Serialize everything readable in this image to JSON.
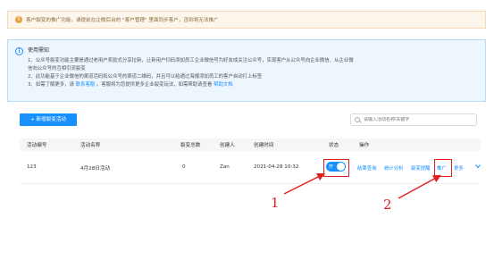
{
  "warning": {
    "text": "客户裂变的推广功能，请提前在企微后台的 \"客户管理\" 里面同步客户，否则将无法推广"
  },
  "notice": {
    "title": "使用需知",
    "lines": [
      "1、公众号裂变功能主要是通过老用户奖励式分享拉新，让新用户扫码添加员工企业微信号为好友成关注公众号，实现客户从公众号向企业微信、从企业微",
      "信向公众号的互相引流裂变",
      "2、此功能基于企业微信的渠道活码和公众号的渠道二维码，并且可以给通过海报添加员工的客户自动打上标签",
      "3、如需了解更多，请"
    ],
    "link1": "联系客服",
    "line3_mid": "。客服将为您提供更多企业裂变玩法，如需帮助请查看",
    "link2": "帮助文档"
  },
  "toolbar": {
    "new_button": "+ 新增裂变活动",
    "search_placeholder": "请输入活动名称/关键字"
  },
  "table": {
    "headers": [
      "活动编号",
      "活动名称",
      "裂变总数",
      "创建人",
      "创建时间",
      "状态",
      "操作"
    ],
    "rows": [
      {
        "id": "123",
        "name": "4月28日活动",
        "total": "0",
        "creator": "Zan",
        "created": "2021-04-28  10:32",
        "status_label": "开",
        "actions": [
          "结果查询",
          "统计分析",
          "裂变提醒",
          "推广",
          "更多"
        ]
      }
    ]
  },
  "annotations": {
    "label1": "1",
    "label2": "2",
    "color": "#e02020"
  },
  "colors": {
    "primary": "#1890ff",
    "warning": "#e6a23c",
    "annotation": "#e02020"
  }
}
